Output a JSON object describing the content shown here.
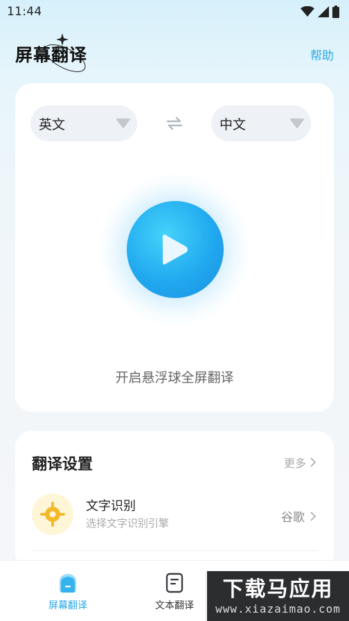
{
  "status_bar": {
    "time": "11:44"
  },
  "header": {
    "title": "屏幕翻译",
    "help_label": "帮助"
  },
  "translator": {
    "source_language": "英文",
    "target_language": "中文",
    "start_label": "开启悬浮球全屏翻译"
  },
  "settings": {
    "title": "翻译设置",
    "more_label": "更多",
    "ocr": {
      "title": "文字识别",
      "subtitle": "选择文字识别引擎",
      "value": "谷歌"
    }
  },
  "tabs": [
    {
      "label": "屏幕翻译",
      "icon": "screen-translate-icon",
      "active": true
    },
    {
      "label": "文本翻译",
      "icon": "document-icon",
      "active": false
    },
    {
      "label": "",
      "icon": "profile-icon",
      "active": false
    }
  ],
  "watermark": {
    "main": "下载马应用",
    "sub": "www.xiazaimao.com"
  },
  "colors": {
    "accent": "#2aa7e6",
    "play_button": "#21a9ef",
    "ocr_icon": "#f4b92a"
  }
}
